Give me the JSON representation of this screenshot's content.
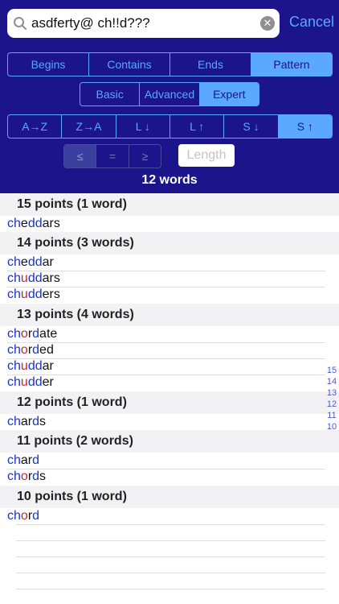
{
  "search": {
    "value": "asdferty@ ch!!d???",
    "cancel": "Cancel"
  },
  "seg_position": [
    "Begins",
    "Contains",
    "Ends",
    "Pattern"
  ],
  "seg_mode": [
    "Basic",
    "Advanced",
    "Expert"
  ],
  "seg_sort": [
    "A→Z",
    "Z→A",
    "L ↓",
    "L ↑",
    "S ↓",
    "S ↑"
  ],
  "seg_compare": [
    "≤",
    "=",
    "≥"
  ],
  "length_placeholder": "Length",
  "word_count": "12 words",
  "sections": [
    {
      "header": "15 points (1 word)"
    },
    {
      "header": "14 points (3 words)"
    },
    {
      "header": "13 points (4 words)"
    },
    {
      "header": "12 points (1 word)"
    },
    {
      "header": "11 points (2 words)"
    },
    {
      "header": "10 points (1 word)"
    }
  ],
  "words": [
    "cheddars",
    "cheddar",
    "chuddars",
    "chudders",
    "chordate",
    "chorded",
    "chuddar",
    "chudder",
    "chards",
    "chard",
    "chords",
    "chord"
  ],
  "index": [
    "15",
    "14",
    "13",
    "12",
    "11",
    "10"
  ],
  "colors": {
    "header_bg": "#1b148a",
    "accent": "#5aa8ff",
    "match_blue": "#1e33c8",
    "match_red": "#c22828"
  }
}
